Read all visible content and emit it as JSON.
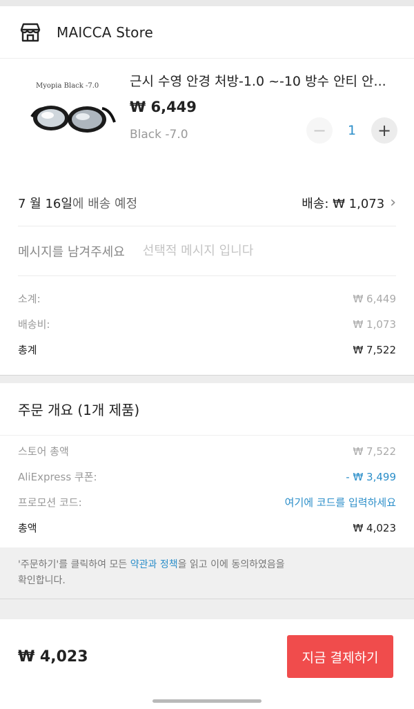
{
  "store": {
    "name": "MAICCA Store",
    "icon": "store-icon"
  },
  "product": {
    "image_caption": "Myopia Black -7.0",
    "title": "근시 수영 안경 처방-1.0 ~-10 방수 안티 안...",
    "price": "₩ 6,449",
    "variant": "Black -7.0",
    "quantity": "1",
    "minus_label": "−",
    "plus_label": "+"
  },
  "shipping": {
    "date_strong": "7 월 16일",
    "date_suffix": "에 배송 예정",
    "fee_label": "배송: ₩ 1,073",
    "chevron": "›"
  },
  "message": {
    "label": "메시지를 남겨주세요",
    "placeholder": "선택적 메시지 입니다"
  },
  "summary": {
    "subtotal_label": "소계:",
    "subtotal_value": "₩ 6,449",
    "shipping_label": "배송비:",
    "shipping_value": "₩ 1,073",
    "total_label": "총계",
    "total_value": "₩ 7,522"
  },
  "overview": {
    "title": "주문 개요 (1개 제품)",
    "store_total_label": "스토어 총액",
    "store_total_value": "₩ 7,522",
    "coupon_label": "AliExpress 쿠폰:",
    "coupon_value": "- ₩ 3,499",
    "promo_label": "프로모션 코드:",
    "promo_value": "여기에 코드를 입력하세요",
    "total_label": "총액",
    "total_value": "₩ 4,023"
  },
  "terms": {
    "prefix": "'주문하기'를 클릭하여 모든 ",
    "link": "약관과 정책",
    "suffix_1": "을 읽고 이에 동의하였음을",
    "line_2": "확인합니다."
  },
  "bottom": {
    "total": "₩ 4,023",
    "pay_label": "지금 결제하기"
  },
  "colors": {
    "accent_blue": "#2b8ec9",
    "pay_red": "#f04c4c"
  }
}
